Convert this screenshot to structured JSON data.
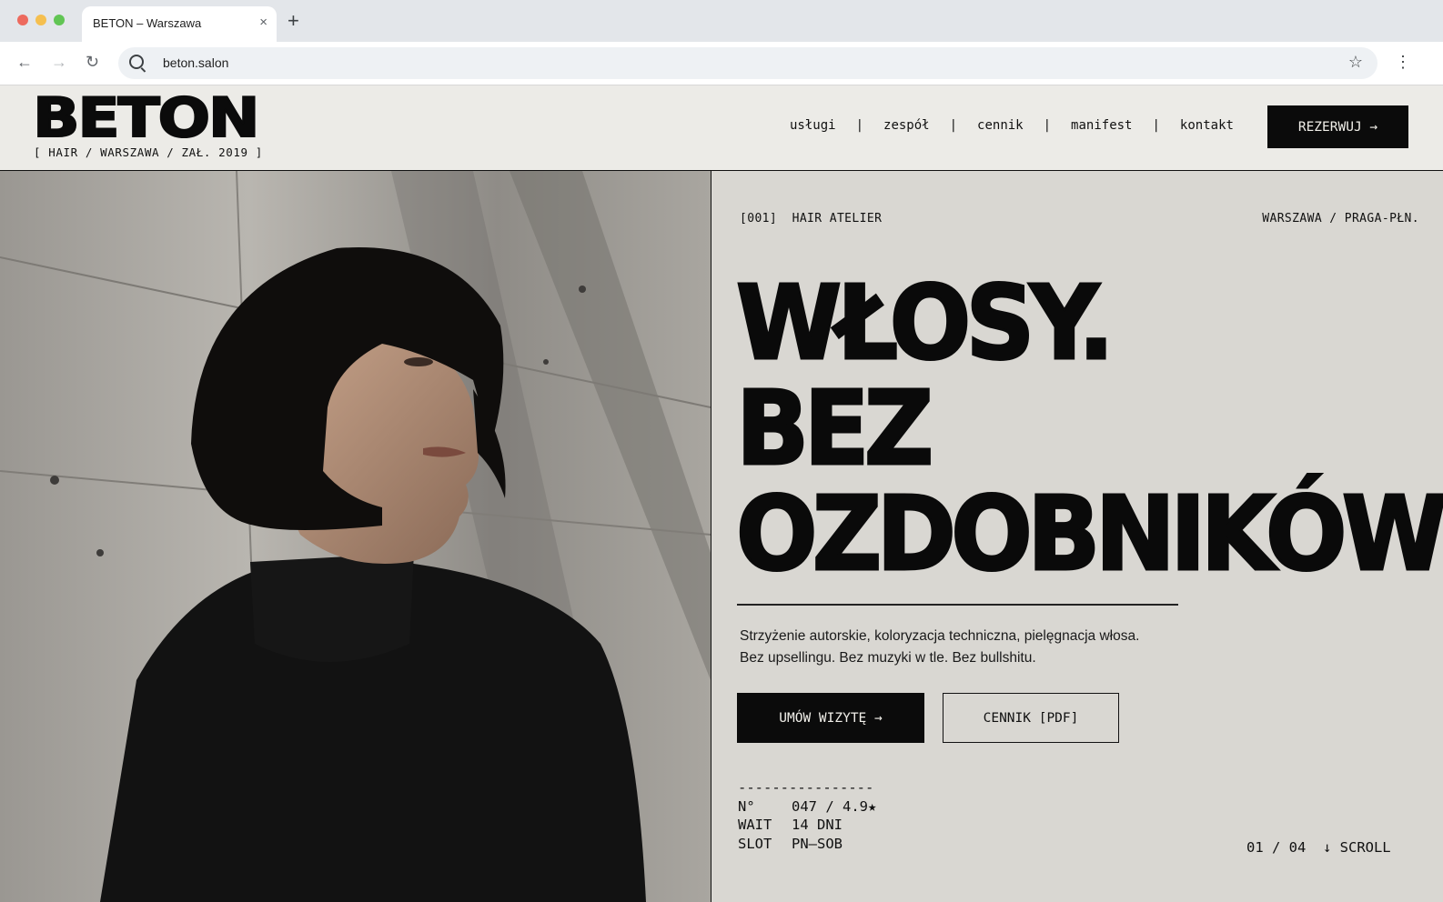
{
  "browser": {
    "tab_title": "BETON – Warszawa",
    "tab_close": "×",
    "new_tab": "+",
    "url": "beton.salon",
    "back": "←",
    "forward": "→",
    "reload": "↻",
    "bookmark": "☆",
    "menu": "⋮",
    "traffic_lights": [
      "#ed6a5e",
      "#f5bf4f",
      "#61c554"
    ]
  },
  "header": {
    "logo": "BETON",
    "tagline": "[ HAIR / WARSZAWA / ZAŁ. 2019 ]",
    "nav": [
      "usługi",
      "zespół",
      "cennik",
      "manifest",
      "kontakt"
    ],
    "nav_separator": "|",
    "reserve_button": "REZERWUJ →"
  },
  "hero": {
    "eyebrow": "[001]  HAIR ATELIER",
    "location": "WARSZAWA / PRAGA-PŁN.",
    "headline": [
      "WŁOSY.",
      "BEZ",
      "OZDOBNIKÓW."
    ],
    "description": [
      "Strzyżenie autorskie, koloryzacja techniczna, pielęgnacja włosa.",
      "Bez upsellingu. Bez muzyki w tle. Bez bullshitu."
    ],
    "primary_button": "UMÓW WIZYTĘ →",
    "secondary_button": "CENNIK [PDF]",
    "stats_rule": "----------------",
    "stats": [
      {
        "key": "N°",
        "value": "047 / 4.9★"
      },
      {
        "key": "WAIT",
        "value": "14 DNI"
      },
      {
        "key": "SLOT",
        "value": "PN–SOB"
      }
    ],
    "pager": "01 / 04  ↓ SCROLL"
  },
  "colors": {
    "background": "#ecebe7",
    "hero_panel": "#d9d7d2",
    "ink": "#0b0b0b",
    "button_text": "#f1efe9"
  },
  "icons": [
    "search-icon",
    "star-icon",
    "back-arrow-icon",
    "forward-arrow-icon",
    "reload-icon",
    "kebab-menu-icon"
  ]
}
